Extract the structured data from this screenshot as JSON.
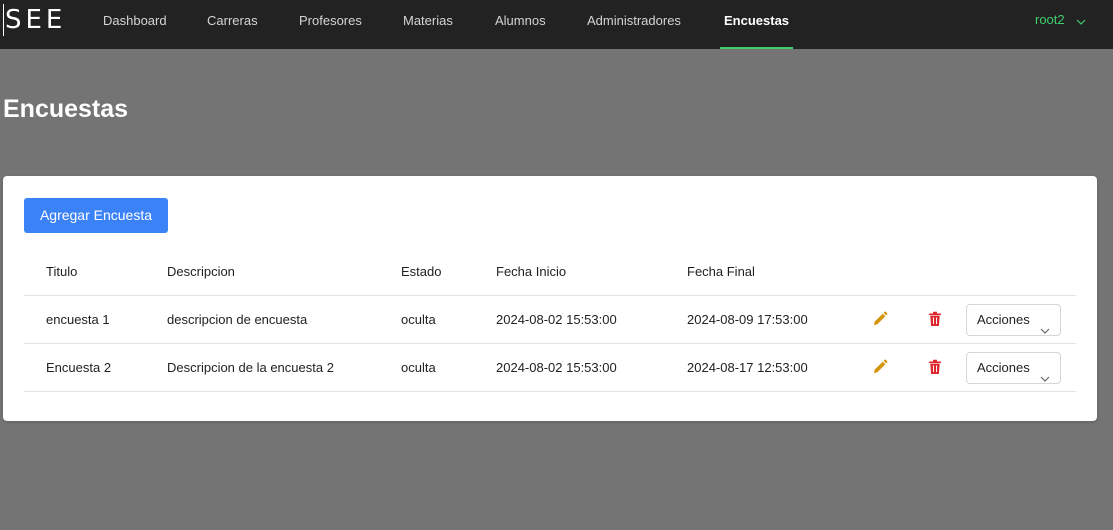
{
  "app": {
    "brand": "SEE"
  },
  "nav": {
    "items": [
      {
        "label": "Dashboard"
      },
      {
        "label": "Carreras"
      },
      {
        "label": "Profesores"
      },
      {
        "label": "Materias"
      },
      {
        "label": "Alumnos"
      },
      {
        "label": "Administradores"
      },
      {
        "label": "Encuestas"
      }
    ],
    "active": "Encuestas",
    "user": "root2"
  },
  "page": {
    "title": "Encuestas",
    "add_button": "Agregar Encuesta"
  },
  "table": {
    "columns": [
      "Titulo",
      "Descripcion",
      "Estado",
      "Fecha Inicio",
      "Fecha Final"
    ],
    "rows": [
      {
        "titulo": "encuesta 1",
        "descripcion": "descripcion de encuesta",
        "estado": "oculta",
        "fecha_inicio": "2024-08-02 15:53:00",
        "fecha_final": "2024-08-09 17:53:00",
        "acciones": "Acciones"
      },
      {
        "titulo": "Encuesta 2",
        "descripcion": "Descripcion de la encuesta 2",
        "estado": "oculta",
        "fecha_inicio": "2024-08-02 15:53:00",
        "fecha_final": "2024-08-17 12:53:00",
        "acciones": "Acciones"
      }
    ]
  },
  "colors": {
    "navbar": "#222222",
    "accent_green": "#3ecf6c",
    "primary_blue": "#3b82f6",
    "edit_icon": "#d4940a",
    "delete_icon": "#e0262d",
    "page_bg": "#747474"
  },
  "icons": {
    "edit": "pencil-icon",
    "delete": "trash-icon",
    "dropdown": "chevron-down-icon"
  }
}
